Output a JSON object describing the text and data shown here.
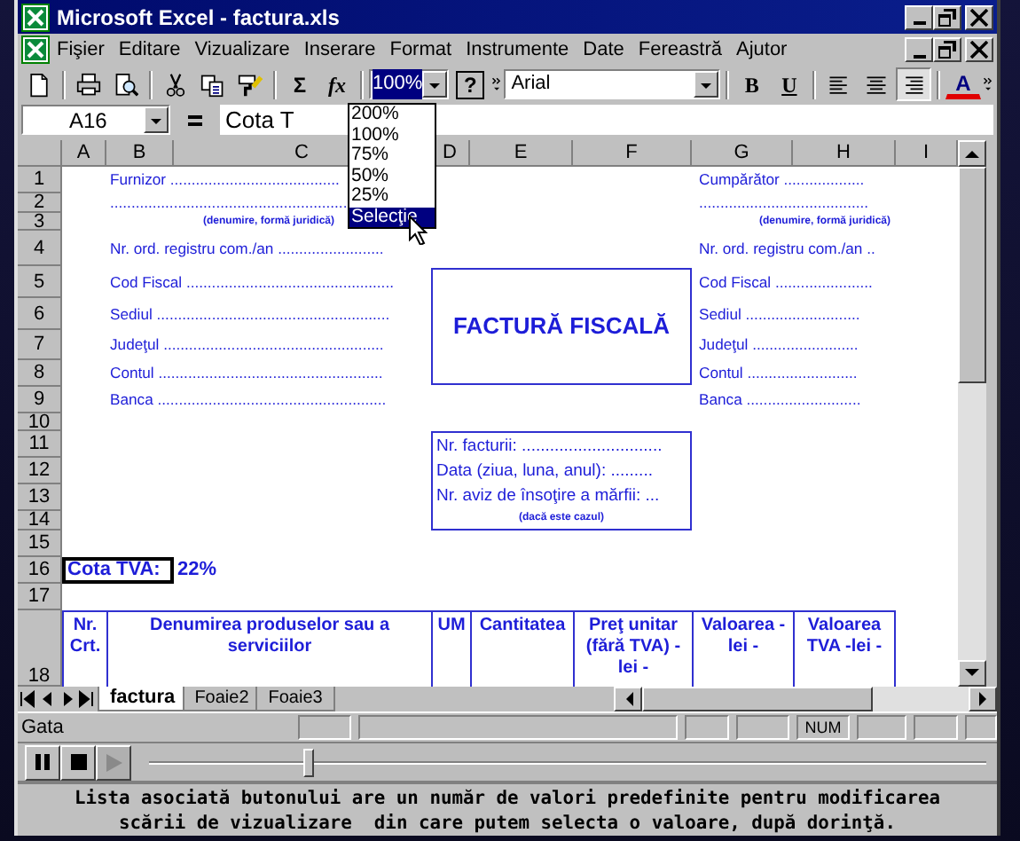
{
  "window": {
    "title": "Microsoft Excel - factura.xls"
  },
  "menu": [
    "Fişier",
    "Editare",
    "Vizualizare",
    "Inserare",
    "Format",
    "Instrumente",
    "Date",
    "Fereastră",
    "Ajutor"
  ],
  "toolbar": [
    {
      "kind": "new"
    },
    {
      "kind": "separator"
    },
    {
      "kind": "print"
    },
    {
      "kind": "preview"
    },
    {
      "kind": "separator"
    },
    {
      "kind": "cut"
    },
    {
      "kind": "copy"
    },
    {
      "kind": "painter"
    },
    {
      "kind": "separator"
    },
    {
      "kind": "sum",
      "label": "Σ"
    },
    {
      "kind": "function",
      "label": "fx"
    },
    {
      "kind": "separator"
    },
    {
      "kind": "zoom",
      "value": "100%"
    },
    {
      "kind": "help",
      "label": "?"
    },
    {
      "kind": "overflow"
    },
    {
      "kind": "font",
      "value": "Arial"
    },
    {
      "kind": "separator"
    },
    {
      "kind": "bold",
      "label": "B",
      "pressed": false
    },
    {
      "kind": "underline",
      "label": "U",
      "pressed": false
    },
    {
      "kind": "separator"
    },
    {
      "kind": "align_left",
      "pressed": false
    },
    {
      "kind": "align_center",
      "pressed": false
    },
    {
      "kind": "align_right",
      "pressed": true
    },
    {
      "kind": "separator"
    },
    {
      "kind": "font_color",
      "label": "A"
    },
    {
      "kind": "overflow"
    }
  ],
  "zoom_menu": {
    "options": [
      {
        "label": "200%",
        "selected": false
      },
      {
        "label": "100%",
        "selected": false
      },
      {
        "label": "75%",
        "selected": false
      },
      {
        "label": "50%",
        "selected": false
      },
      {
        "label": "25%",
        "selected": false
      },
      {
        "label": "Selecţie",
        "selected": true
      }
    ]
  },
  "formula_bar": {
    "name_box": "A16",
    "content": "Cota T"
  },
  "sheet": {
    "columns": [
      "A",
      "B",
      "C",
      "D",
      "E",
      "F",
      "G",
      "H",
      "I"
    ],
    "rows": [
      "1",
      "2",
      "3",
      "4",
      "5",
      "6",
      "7",
      "8",
      "9",
      "10",
      "11",
      "12",
      "13",
      "14",
      "15",
      "16",
      "17",
      "18"
    ],
    "supplier": [
      "Furnizor ........................................",
      "........................................................",
      "(denumire, formă juridică)",
      "Nr. ord. registru com./an .........................",
      "Cod Fiscal .................................................",
      "Sediul .......................................................",
      "Judeţul ....................................................",
      "Contul .....................................................",
      "Banca ......................................................"
    ],
    "buyer": [
      "Cumpărător ...................",
      "........................................",
      "(denumire, formă juridică)",
      "Nr. ord. registru com./an ..",
      "Cod Fiscal .......................",
      "Sediul ...........................",
      "Judeţul .........................",
      "Contul ..........................",
      "Banca ..........................."
    ],
    "title_box": "FACTURĂ FISCALĂ",
    "invoice_box": [
      "Nr. facturii: ..............................",
      "Data (ziua, luna, anul): .........",
      "Nr. aviz de însoţire a mărfii: ...",
      "(dacă este cazul)"
    ],
    "vat": {
      "label": "Cota TVA:",
      "value": "22%"
    },
    "table_header": [
      "Nr. Crt.",
      "Denumirea produselor sau a serviciilor",
      "UM",
      "Cantitatea",
      "Preţ unitar (fără TVA) - lei -",
      "Valoarea - lei -",
      "Valoarea TVA -lei -"
    ]
  },
  "sheet_tabs": [
    {
      "label": "factura",
      "selected": true
    },
    {
      "label": "Foaie2",
      "selected": false
    },
    {
      "label": "Foaie3",
      "selected": false
    }
  ],
  "status_bar": {
    "text": "Gata",
    "indicator": "NUM"
  },
  "player": {
    "buttons": [
      {
        "kind": "pause",
        "disabled": false
      },
      {
        "kind": "stop",
        "disabled": false
      },
      {
        "kind": "play",
        "disabled": true
      }
    ],
    "level": 0.19
  },
  "caption": [
    "Lista asociată butonului are un număr de valori predefinite pentru modificarea",
    "scării de vizualizare  din care putem selecta o valoare, după dorinţă."
  ]
}
